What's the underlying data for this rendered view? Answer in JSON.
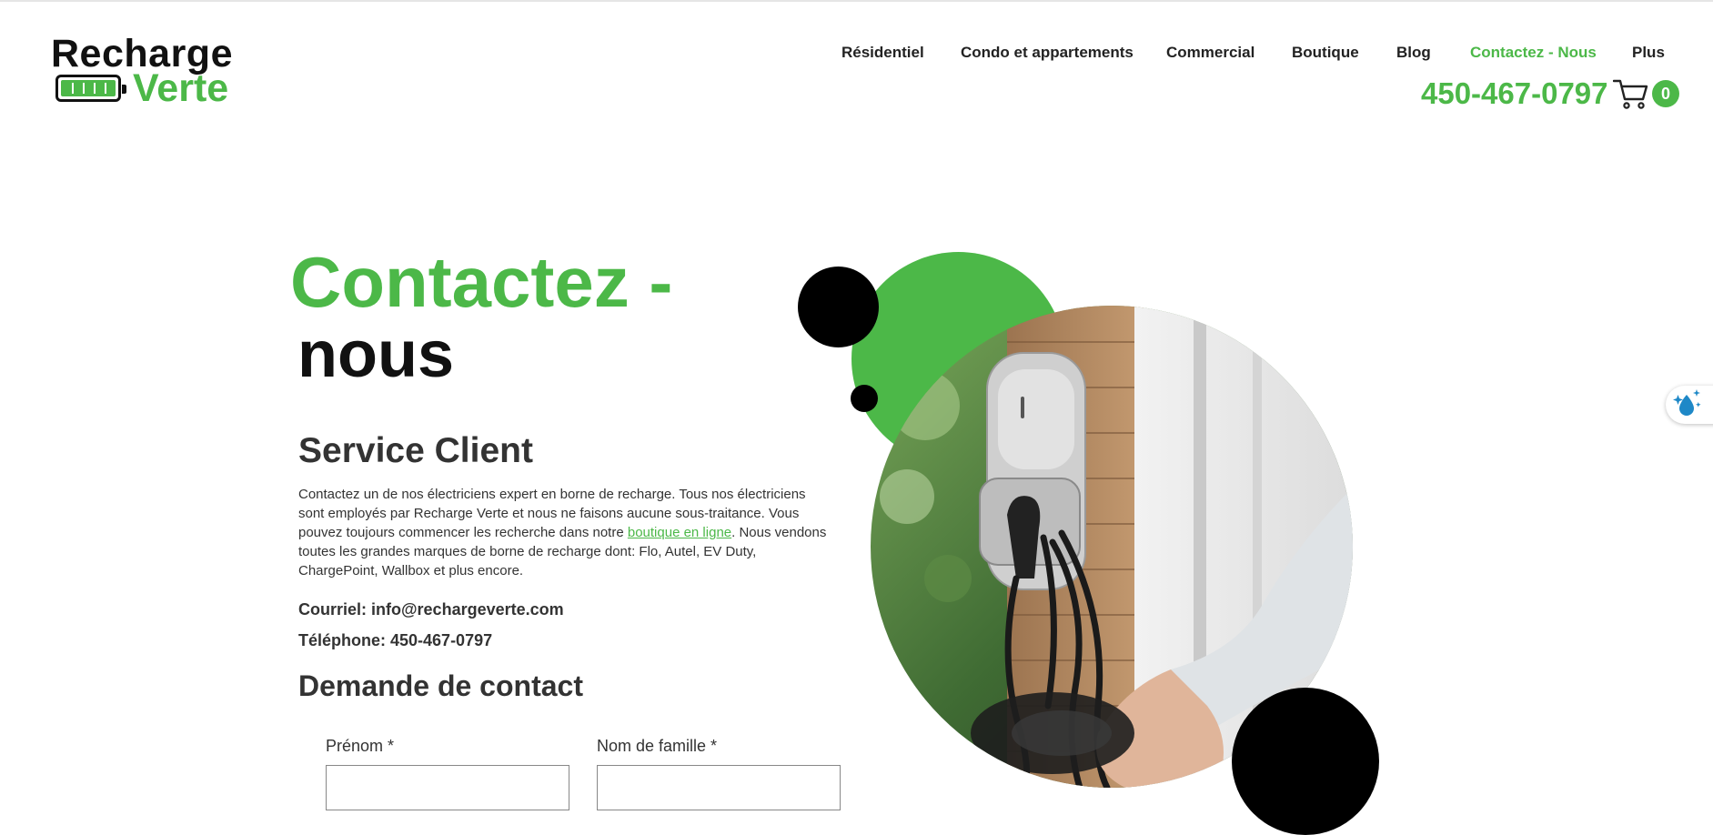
{
  "brand": {
    "name_line1": "Recharge",
    "name_line2": "Verte",
    "accent_color": "#4cb848"
  },
  "nav": {
    "items": [
      {
        "label": "Résidentiel",
        "active": false
      },
      {
        "label": "Condo et appartements",
        "active": false
      },
      {
        "label": "Commercial",
        "active": false
      },
      {
        "label": "Boutique",
        "active": false
      },
      {
        "label": "Blog",
        "active": false
      },
      {
        "label": "Contactez - Nous",
        "active": true
      },
      {
        "label": "Plus",
        "active": false
      }
    ]
  },
  "header": {
    "phone": "450-467-0797",
    "cart_icon": "cart-icon",
    "cart_count": "0"
  },
  "page": {
    "title_line1": "Contactez -",
    "title_line2": "nous"
  },
  "service": {
    "heading": "Service Client",
    "paragraph_before_link": "Contactez un de nos électriciens expert en borne de recharge. Tous nos électriciens sont employés par Recharge Verte et nous ne faisons aucune sous-traitance. Vous pouvez toujours commencer les recherche dans notre ",
    "link_text": "boutique en ligne",
    "paragraph_after_link": ".  Nous vendons toutes les grandes marques de borne de recharge dont: Flo, Autel, EV Duty, ChargePoint, Wallbox et plus encore.",
    "email_line": "Courriel: info@rechargeverte.com",
    "phone_line": "Téléphone: 450-467-0797"
  },
  "form": {
    "heading": "Demande de contact",
    "first_name_label": "Prénom *",
    "last_name_label": "Nom de famille *",
    "first_name_value": "",
    "last_name_value": ""
  },
  "accessibility": {
    "icon": "accessibility-droplet-icon"
  }
}
